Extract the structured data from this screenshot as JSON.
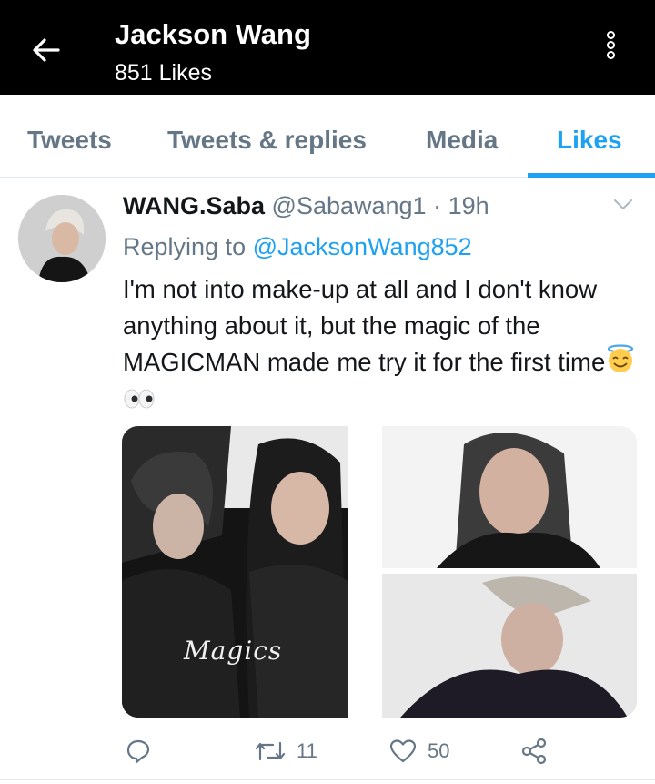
{
  "header": {
    "title": "Jackson Wang",
    "subtitle": "851 Likes"
  },
  "tabs": [
    {
      "label": "Tweets",
      "active": false
    },
    {
      "label": "Tweets & replies",
      "active": false
    },
    {
      "label": "Media",
      "active": false
    },
    {
      "label": "Likes",
      "active": true
    }
  ],
  "tweet": {
    "name": "WANG.Saba",
    "handle": "@Sabawang1",
    "separator": "·",
    "time": "19h",
    "replying_prefix": "Replying to",
    "replying_to": "@JacksonWang852",
    "text": "I'm not into make-up at all and I don't know anything about it, but the magic of the MAGICMAN made me try it for the first time",
    "emojis": [
      "halo-smile-emoji",
      "eyes-emoji"
    ],
    "media_caption": "Magics",
    "actions": {
      "reply_count": "",
      "retweet_count": "11",
      "like_count": "50"
    }
  },
  "colors": {
    "accent": "#1da1f2",
    "header_bg": "#000000",
    "secondary_text": "#657786"
  }
}
